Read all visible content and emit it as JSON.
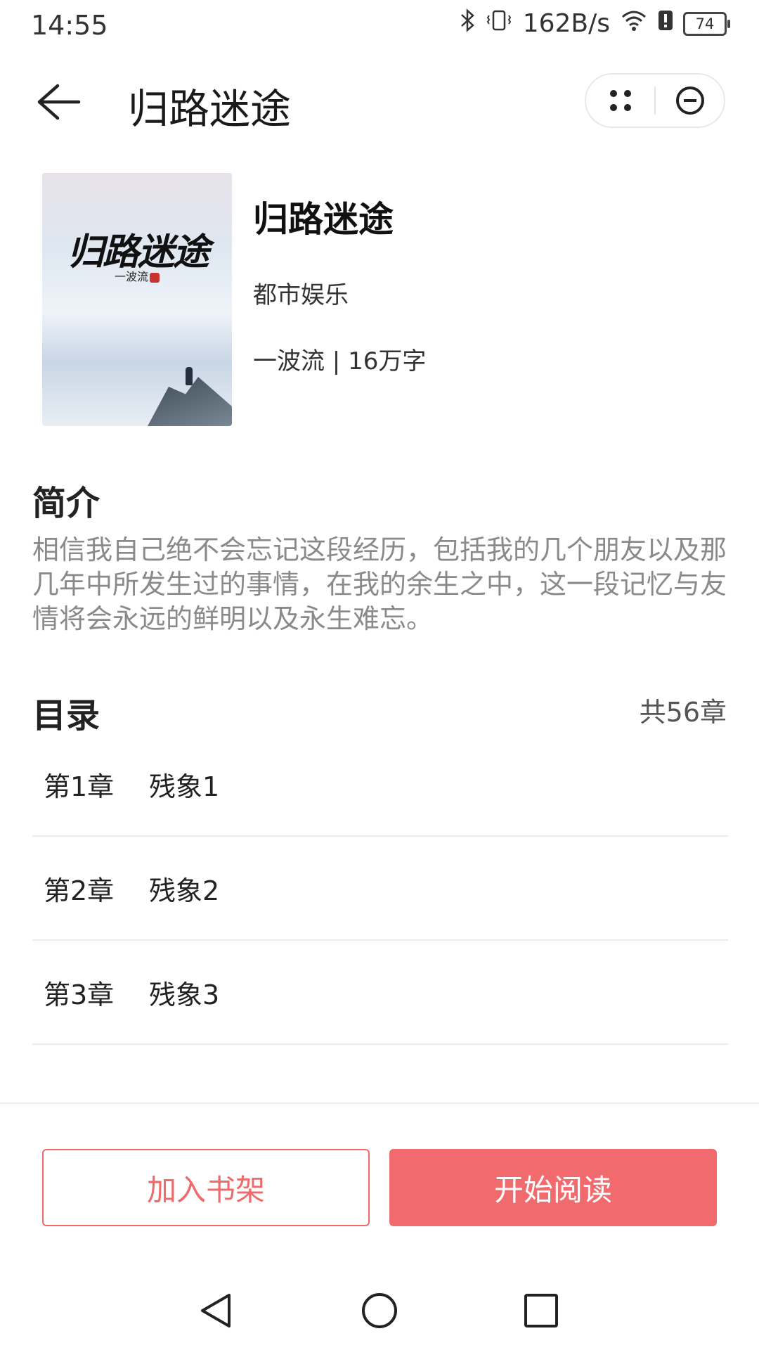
{
  "status_bar": {
    "time": "14:55",
    "net_speed": "162B/s",
    "battery": "74"
  },
  "app_bar": {
    "title": "归路迷途"
  },
  "book": {
    "cover_title": "归路迷途",
    "cover_author": "一波流",
    "title": "归路迷途",
    "genre": "都市娱乐",
    "meta": "一波流 | 16万字"
  },
  "intro": {
    "heading": "简介",
    "text": "相信我自己绝不会忘记这段经历，包括我的几个朋友以及那几年中所发生过的事情，在我的余生之中，这一段记忆与友情将会永远的鲜明以及永生难忘。"
  },
  "toc": {
    "heading": "目录",
    "count": "共56章",
    "chapters": [
      {
        "num": "第1章",
        "name": "残象1"
      },
      {
        "num": "第2章",
        "name": "残象2"
      },
      {
        "num": "第3章",
        "name": "残象3"
      }
    ]
  },
  "actions": {
    "add_shelf": "加入书架",
    "start_read": "开始阅读"
  },
  "colors": {
    "accent": "#f16a6e"
  }
}
